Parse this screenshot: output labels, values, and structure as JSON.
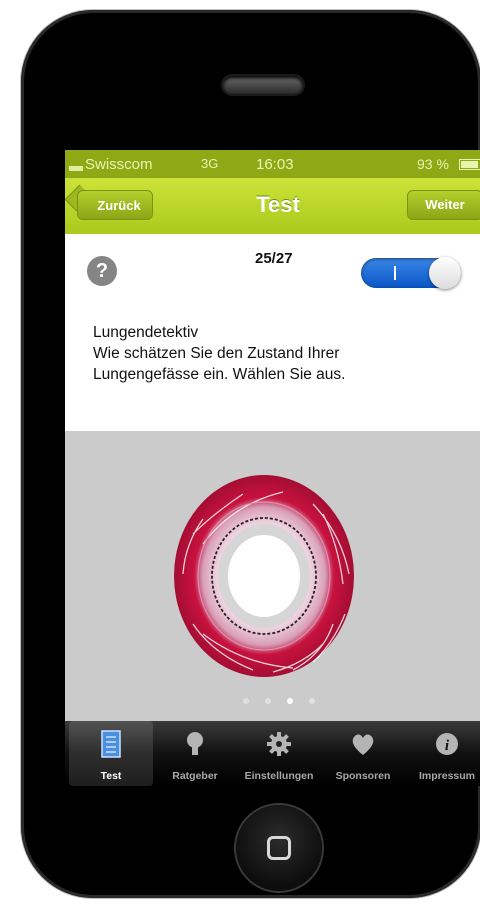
{
  "status_bar": {
    "carrier": "Swisscom",
    "network": "3G",
    "time": "16:03",
    "battery": "93 %"
  },
  "nav_bar": {
    "back_label": "Zurück",
    "title": "Test",
    "forward_label": "Weiter"
  },
  "question_card": {
    "help_symbol": "?",
    "progress": "25/27",
    "question_lines": [
      "Lungendetektiv",
      "Wie schätzen Sie den Zustand Ihrer",
      "Lungengefässe ein. Wählen Sie aus."
    ],
    "toggle_on": true
  },
  "image_carousel": {
    "pages": 4,
    "current_page": 3
  },
  "tab_bar": {
    "items": [
      {
        "label": "Test",
        "icon": "document-icon",
        "active": true
      },
      {
        "label": "Ratgeber",
        "icon": "lightbulb-icon",
        "active": false
      },
      {
        "label": "Einstellungen",
        "icon": "gear-icon",
        "active": false
      },
      {
        "label": "Sponsoren",
        "icon": "heart-icon",
        "active": false
      },
      {
        "label": "Impressum",
        "icon": "info-icon",
        "active": false
      }
    ]
  },
  "colors": {
    "nav_green": "#a9c91c",
    "status_green": "#8fa815",
    "toggle_blue": "#1a66d6",
    "vessel_red": "#c8123e"
  }
}
